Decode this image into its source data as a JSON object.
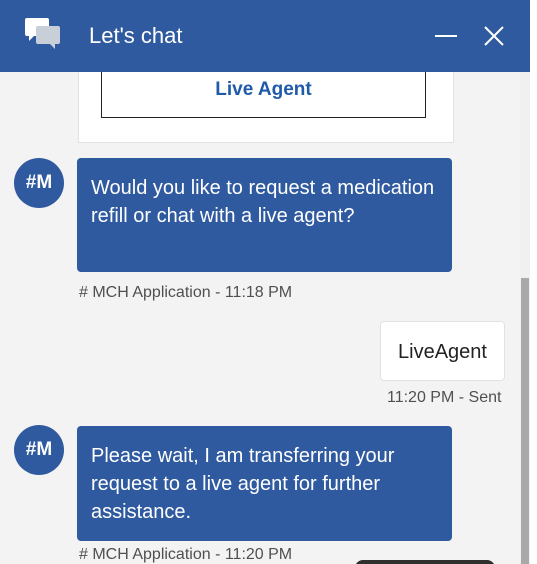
{
  "header": {
    "title": "Let's chat",
    "icons": {
      "chat": "chat-bubbles-icon",
      "minimize": "minimize-icon",
      "close": "close-icon"
    }
  },
  "card": {
    "button_label": "Live Agent"
  },
  "messages": [
    {
      "from": "bot",
      "avatar": "#M",
      "text": "Would you like to request a medication refill or chat with a live agent?",
      "meta": "# MCH Application - 11:18 PM"
    },
    {
      "from": "user",
      "text": "LiveAgent",
      "meta": "11:20 PM - Sent"
    },
    {
      "from": "bot",
      "avatar": "#M",
      "text": "Please wait, I am transferring your request to a live agent for further assistance.",
      "meta": "# MCH Application - 11:20 PM"
    }
  ],
  "colors": {
    "brand": "#2f5a9f",
    "link": "#1f5ba8",
    "background": "#f3f3f4"
  }
}
